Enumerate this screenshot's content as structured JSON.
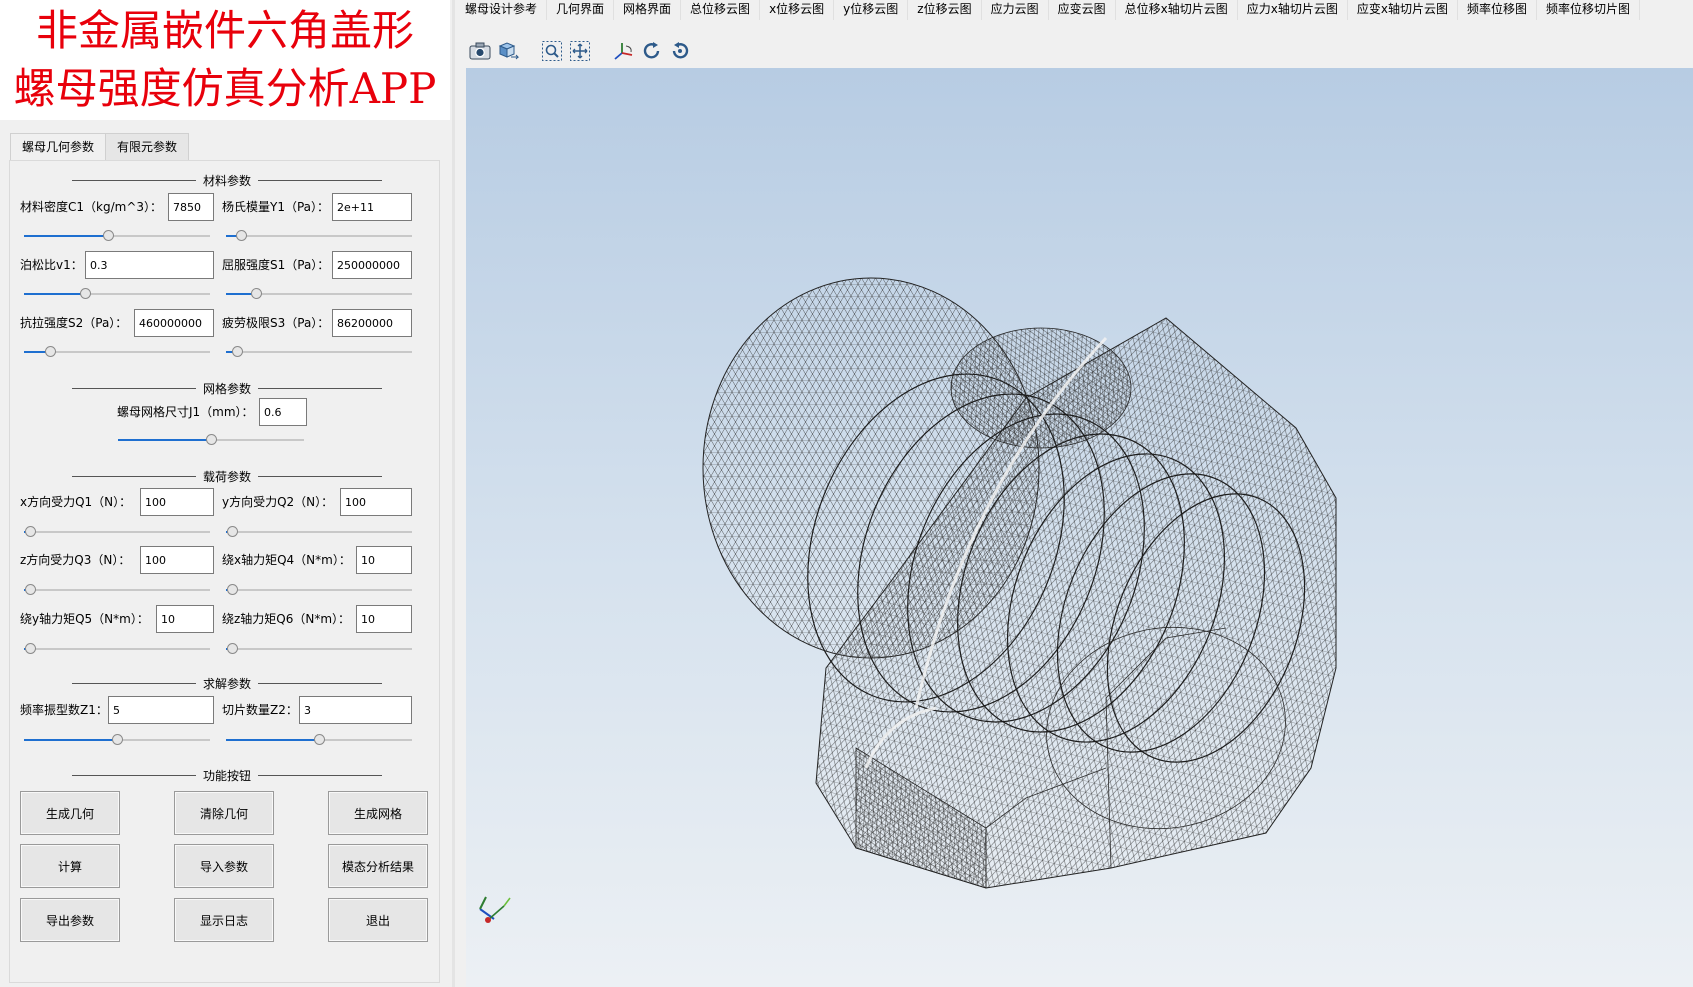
{
  "app_title": {
    "line1": "非金属嵌件六角盖形",
    "line2": "螺母强度仿真分析APP",
    "color": "#e8000b"
  },
  "tabs": [
    {
      "label": "螺母几何参数"
    },
    {
      "label": "有限元参数"
    }
  ],
  "sections": {
    "material": "材料参数",
    "mesh": "网格参数",
    "load": "载荷参数",
    "solve": "求解参数",
    "functions": "功能按钮"
  },
  "material": {
    "density": {
      "label": "材料密度C1（kg/m^3）：",
      "value": "7850",
      "slider": 0.45
    },
    "youngs": {
      "label": "杨氏模量Y1（Pa）：",
      "value": "2e+11",
      "slider": 0.08
    },
    "poisson": {
      "label": "泊松比v1：",
      "value": "0.3",
      "slider": 0.33
    },
    "yield": {
      "label": "屈服强度S1（Pa）：",
      "value": "250000000",
      "slider": 0.16
    },
    "tensile": {
      "label": "抗拉强度S2（Pa）：",
      "value": "460000000",
      "slider": 0.14
    },
    "fatigue": {
      "label": "疲劳极限S3（Pa）：",
      "value": "86200000",
      "slider": 0.06
    }
  },
  "mesh": {
    "size": {
      "label": "螺母网格尺寸J1（mm）：",
      "value": "0.6",
      "slider": 0.5
    }
  },
  "load": {
    "q1": {
      "label": "x方向受力Q1（N）：",
      "value": "100",
      "slider": 0.03
    },
    "q2": {
      "label": "y方向受力Q2（N）：",
      "value": "100",
      "slider": 0.03
    },
    "q3": {
      "label": "z方向受力Q3（N）：",
      "value": "100",
      "slider": 0.03
    },
    "q4": {
      "label": "绕x轴力矩Q4（N*m）：",
      "value": "10",
      "slider": 0.03
    },
    "q5": {
      "label": "绕y轴力矩Q5（N*m）：",
      "value": "10",
      "slider": 0.03
    },
    "q6": {
      "label": "绕z轴力矩Q6（N*m）：",
      "value": "10",
      "slider": 0.03
    }
  },
  "solve": {
    "z1": {
      "label": "频率振型数Z1：",
      "value": "5",
      "slider": 0.5
    },
    "z2": {
      "label": "切片数量Z2：",
      "value": "3",
      "slider": 0.5
    }
  },
  "buttons": {
    "gen_geometry": "生成几何",
    "clear_geometry": "清除几何",
    "gen_mesh": "生成网格",
    "compute": "计算",
    "import_params": "导入参数",
    "modal_results": "模态分析结果",
    "export_params": "导出参数",
    "show_log": "显示日志",
    "exit": "退出"
  },
  "menu": [
    "螺母设计参考",
    "几何界面",
    "网格界面",
    "总位移云图",
    "x位移云图",
    "y位移云图",
    "z位移云图",
    "应力云图",
    "应变云图",
    "总位移x轴切片云图",
    "应力x轴切片云图",
    "应变x轴切片云图",
    "频率位移图",
    "频率位移切片图"
  ],
  "toolbar_icons": [
    "camera-icon",
    "view-cube-icon",
    "zoom-box-icon",
    "zoom-extents-icon",
    "axes-orient-icon",
    "rotate-cw-icon",
    "rotate-ccw-icon"
  ],
  "colors": {
    "slider_fill": "#1e6fd0",
    "viewport_top": "#b7cce3",
    "viewport_bottom": "#ecf0f4"
  }
}
